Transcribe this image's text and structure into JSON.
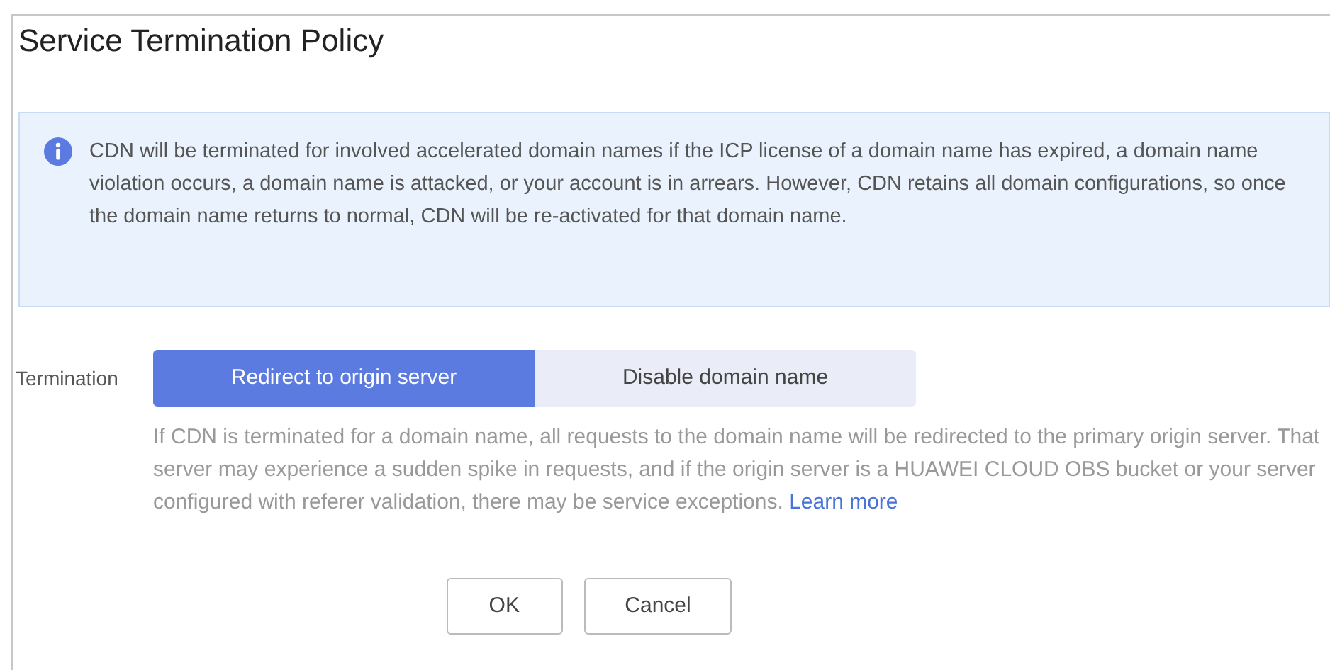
{
  "dialog": {
    "title": "Service Termination Policy"
  },
  "notice": {
    "text": "CDN will be terminated for involved accelerated domain names if the ICP license of a domain name has expired, a domain name violation occurs, a domain name is attacked, or your account is in arrears. However, CDN retains all domain configurations, so once the domain name returns to normal, CDN will be re-activated for that domain name."
  },
  "termination": {
    "label": "Termination",
    "options": [
      {
        "label": "Redirect to origin server",
        "selected": true
      },
      {
        "label": "Disable domain name",
        "selected": false
      }
    ],
    "description": "If CDN is terminated for a domain name, all requests to the domain name will be redirected to the primary origin server. That server may experience a sudden spike in requests, and if the origin server is a HUAWEI CLOUD OBS bucket or your server configured with referer validation, there may be service exceptions.",
    "link": "Learn more"
  },
  "buttons": [
    "OK",
    "Cancel"
  ]
}
